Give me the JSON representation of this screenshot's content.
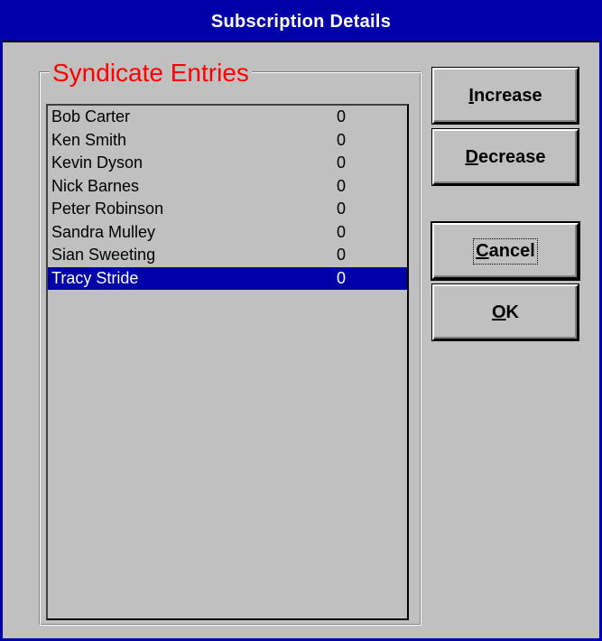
{
  "window": {
    "title": "Subscription Details"
  },
  "group": {
    "label": "Syndicate Entries",
    "label_color": "#ff0000"
  },
  "list": {
    "selected_index": 7,
    "selection_color": "#0000a8",
    "items": [
      {
        "name": "Bob Carter",
        "count": "0"
      },
      {
        "name": "Ken Smith",
        "count": "0"
      },
      {
        "name": "Kevin Dyson",
        "count": "0"
      },
      {
        "name": "Nick Barnes",
        "count": "0"
      },
      {
        "name": "Peter Robinson",
        "count": "0"
      },
      {
        "name": "Sandra Mulley",
        "count": "0"
      },
      {
        "name": "Sian Sweeting",
        "count": "0"
      },
      {
        "name": "Tracy Stride",
        "count": "0"
      }
    ]
  },
  "buttons": {
    "increase": {
      "mnemonic": "I",
      "rest": "ncrease"
    },
    "decrease": {
      "mnemonic": "D",
      "rest": "ecrease"
    },
    "cancel": {
      "mnemonic": "C",
      "rest": "ancel"
    },
    "ok": {
      "mnemonic": "O",
      "rest": "K"
    }
  }
}
